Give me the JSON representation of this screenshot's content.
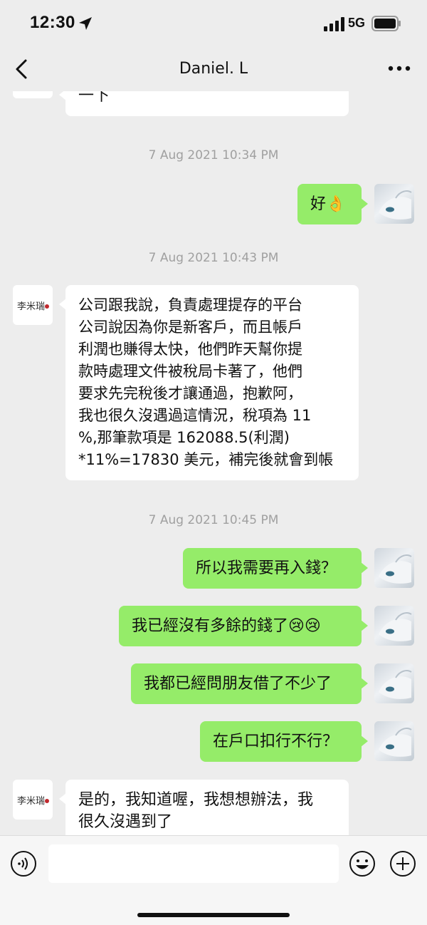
{
  "status": {
    "time": "12:30",
    "network": "5G"
  },
  "header": {
    "title": "Daniel. L"
  },
  "messages": [
    {
      "side": "left",
      "text": "一下"
    },
    {
      "type": "timestamp",
      "text": "7 Aug 2021 10:34 PM"
    },
    {
      "side": "right",
      "text": "好👌"
    },
    {
      "type": "timestamp",
      "text": "7 Aug 2021 10:43 PM"
    },
    {
      "side": "left",
      "text": "公司跟我說，負責處理提存的平台\n公司說因為你是新客戶，而且帳戶\n利潤也賺得太快，他們昨天幫你提\n款時處理文件被稅局卡著了，他們\n要求先完稅後才讓通過，抱歉阿，\n我也很久沒遇過這情況，稅項為 11\n%,那筆款項是 162088.5(利潤)\n*11%=17830 美元，補完後就會到帳"
    },
    {
      "type": "timestamp",
      "text": "7 Aug 2021 10:45 PM"
    },
    {
      "side": "right",
      "text": "所以我需要再入錢？"
    },
    {
      "side": "right",
      "text": "我已經沒有多餘的錢了😢😢"
    },
    {
      "side": "right",
      "text": "我都已經問朋友借了不少了"
    },
    {
      "side": "right",
      "text": "在戶口扣行不行？"
    },
    {
      "side": "left",
      "text": "是的，我知道喔，我想想辦法，我\n很久沒遇到了"
    }
  ],
  "input": {
    "placeholder": ""
  },
  "icons": {
    "back": "chevron-left-icon",
    "more": "more-dots-icon",
    "voice": "voice-icon",
    "emoji": "emoji-icon",
    "plus": "plus-icon"
  },
  "colors": {
    "background": "#ededed",
    "sent_bubble": "#95ec69",
    "received_bubble": "#ffffff",
    "timestamp": "#a0a0a0"
  }
}
